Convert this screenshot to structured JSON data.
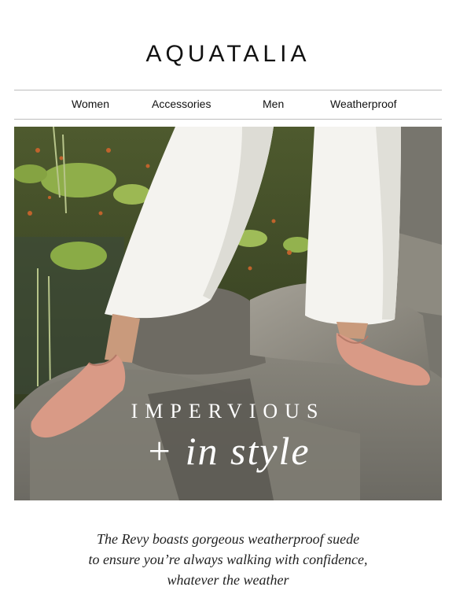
{
  "brand": {
    "logo_text": "AQUATALIA"
  },
  "nav": {
    "items": [
      "Women",
      "Accessories",
      "Men",
      "Weatherproof"
    ]
  },
  "hero": {
    "headline_line1": "IMPERVIOUS",
    "headline_line2": "+ in style"
  },
  "body": {
    "lines": [
      "The Revy boasts gorgeous weatherproof suede",
      "to ensure you’re always walking with confidence,",
      "whatever the weather"
    ]
  },
  "colors": {
    "text": "#111111",
    "divider": "#bdbdbd",
    "shoe": "#d99a86",
    "pants": "#f4f3ef"
  }
}
